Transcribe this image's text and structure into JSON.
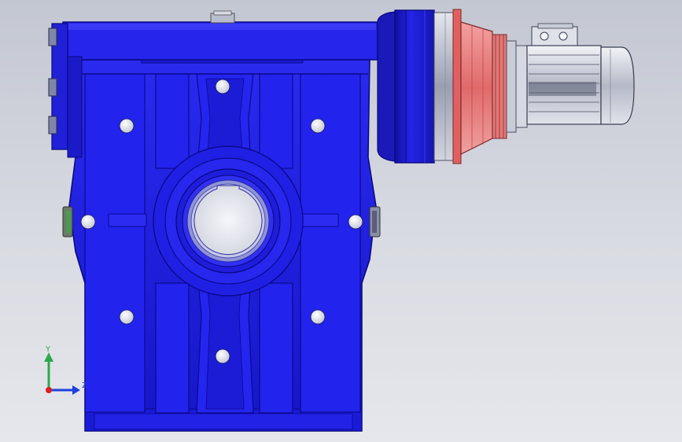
{
  "viewport": {
    "background_top": "#c3c7d2",
    "background_bottom": "#e6e7ec"
  },
  "model": {
    "components": [
      {
        "name": "gearbox-housing",
        "color": "#1f1fe6"
      },
      {
        "name": "input-flange",
        "color": "#1c1cc8"
      },
      {
        "name": "planetary-adapter",
        "color": "#e97d7d"
      },
      {
        "name": "electric-motor",
        "color": "#c8ccd6"
      }
    ]
  },
  "triad": {
    "y_label": "Y",
    "z_label": "Z",
    "y_color": "#2ea84a",
    "z_color": "#1f3fe0",
    "x_color": "#d81e1e"
  }
}
